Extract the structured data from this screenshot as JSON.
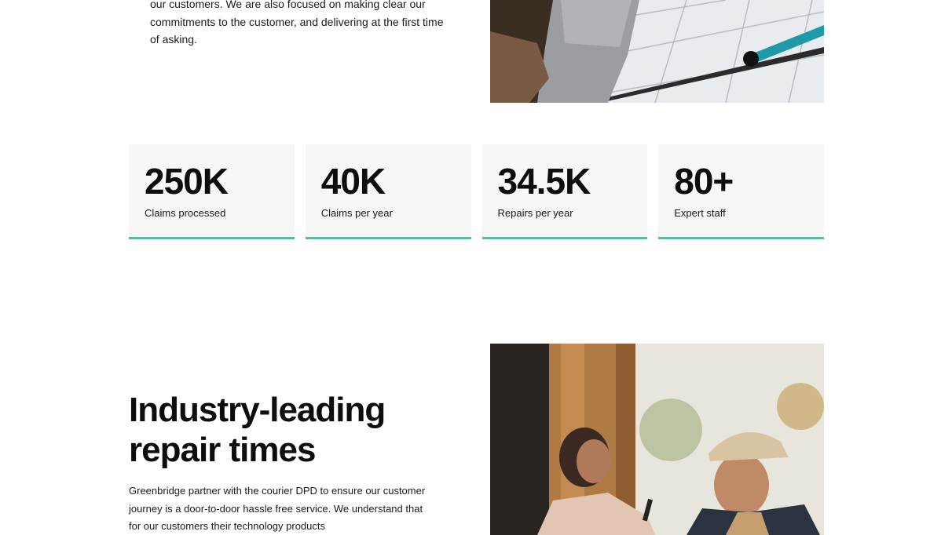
{
  "intro": {
    "text": "our customers.  We are also focused on making clear our commitments to the customer, and delivering at the first time of asking."
  },
  "stats": [
    {
      "value": "250K",
      "label": "Claims processed"
    },
    {
      "value": "40K",
      "label": "Claims per year"
    },
    {
      "value": "34.5K",
      "label": "Repairs per year"
    },
    {
      "value": "80+",
      "label": "Expert staff"
    }
  ],
  "repair_section": {
    "heading": "Industry-leading repair times",
    "body": "Greenbridge partner with the courier DPD to ensure our customer journey is a door-to-door hassle free service.  We understand that for our customers their technology products"
  },
  "colors": {
    "accent": "#5fb5a0",
    "card_bg": "#f7f7f7",
    "text": "#111111"
  },
  "images": {
    "top": "technician-repair-photo",
    "bottom": "courier-delivery-photo"
  }
}
